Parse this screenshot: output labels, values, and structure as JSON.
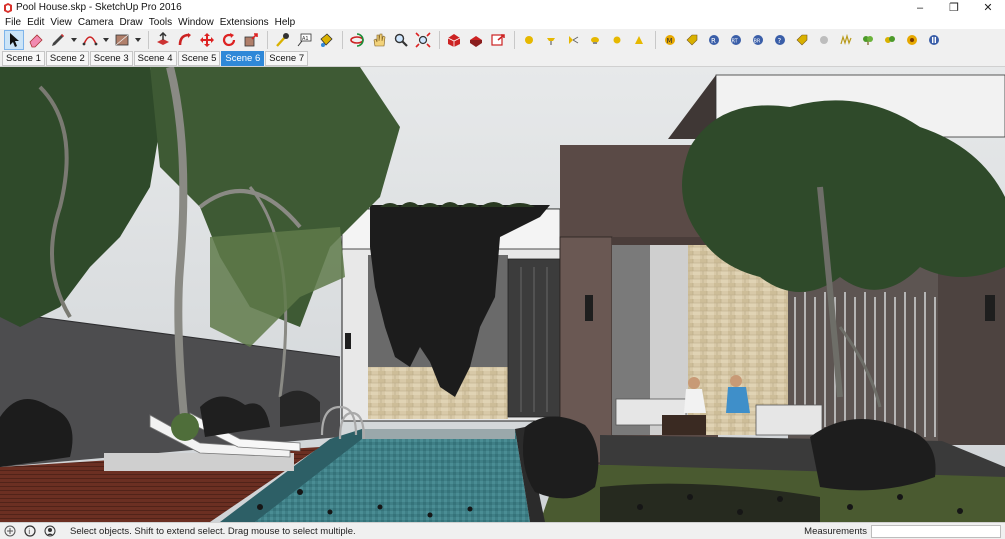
{
  "window": {
    "title": "Pool House.skp - SketchUp Pro 2016",
    "minimize": "–",
    "maximize": "❐",
    "close": "✕"
  },
  "menu": {
    "items": [
      "File",
      "Edit",
      "View",
      "Camera",
      "Draw",
      "Tools",
      "Window",
      "Extensions",
      "Help"
    ]
  },
  "scenes": {
    "tabs": [
      "Scene 1",
      "Scene 2",
      "Scene 3",
      "Scene 4",
      "Scene 5",
      "Scene 6",
      "Scene 7"
    ],
    "active": "Scene 6"
  },
  "status": {
    "message": "Select objects. Shift to extend select. Drag mouse to select multiple.",
    "measurements_label": "Measurements",
    "measurements_value": ""
  },
  "colors": {
    "accent": "#2f88d8",
    "sky": "#dfe2e4",
    "wall_brown": "#5a4a46",
    "pool_water": "#3f7f86",
    "stone": "#d6c7a6"
  }
}
